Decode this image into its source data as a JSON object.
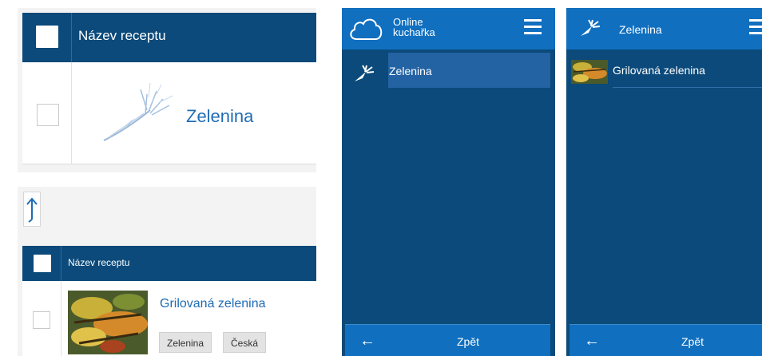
{
  "category_table": {
    "header_label": "Název receptu",
    "row": {
      "name": "Zelenina"
    }
  },
  "recipe_table": {
    "header_label": "Název receptu",
    "row": {
      "name": "Grilovaná zelenina",
      "tags": [
        "Zelenina",
        "Česká"
      ]
    }
  },
  "mobile_menu": {
    "app_title_line1": "Online",
    "app_title_line2": "kuchařka",
    "items": [
      {
        "label": "Zelenina",
        "icon": "carrot-icon"
      }
    ],
    "back_label": "Zpět"
  },
  "mobile_list": {
    "title": "Zelenina",
    "items": [
      {
        "label": "Grilovaná zelenina"
      }
    ],
    "back_label": "Zpět"
  },
  "colors": {
    "header_navy": "#0b4a7a",
    "mobile_bar_blue": "#106fbf",
    "link_blue": "#1f6cb3"
  }
}
